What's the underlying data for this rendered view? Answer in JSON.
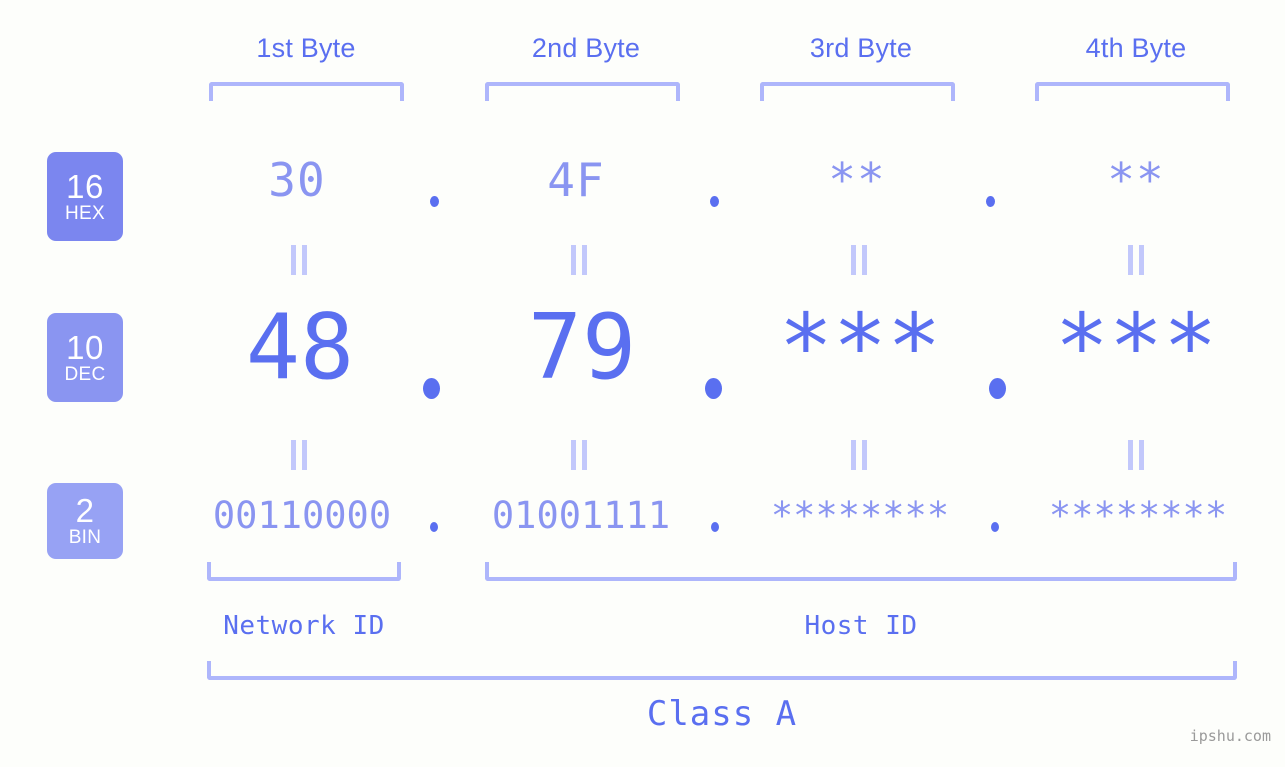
{
  "background_color": "#fdfefb",
  "colors": {
    "accent_strong": "#5a6ff0",
    "accent_mid": "#8a95f1",
    "accent_light": "#aeb6fb",
    "bracket": "#aeb6fb",
    "badge_hex": "#7b86ef",
    "badge_dec": "#8a95f1",
    "badge_bin": "#97a2f4",
    "watermark": "#9a9a9a"
  },
  "byte_headers": [
    {
      "label": "1st Byte"
    },
    {
      "label": "2nd Byte"
    },
    {
      "label": "3rd Byte"
    },
    {
      "label": "4th Byte"
    }
  ],
  "rows": {
    "hex": {
      "badge_number": "16",
      "badge_name": "HEX",
      "values": [
        "30",
        "4F",
        "**",
        "**"
      ],
      "separators": [
        ".",
        ".",
        "."
      ]
    },
    "dec": {
      "badge_number": "10",
      "badge_name": "DEC",
      "values": [
        "48",
        "79",
        "***",
        "***"
      ],
      "separators": [
        ".",
        ".",
        "."
      ]
    },
    "bin": {
      "badge_number": "2",
      "badge_name": "BIN",
      "values": [
        "00110000",
        "01001111",
        "********",
        "********"
      ],
      "separators": [
        ".",
        ".",
        "."
      ]
    }
  },
  "equals_marks": {
    "symbol": "||",
    "hex_to_dec_count": 4,
    "dec_to_bin_count": 4
  },
  "id_sections": [
    {
      "label": "Network ID"
    },
    {
      "label": "Host ID"
    }
  ],
  "class_label": "Class A",
  "watermark": "ipshu.com"
}
